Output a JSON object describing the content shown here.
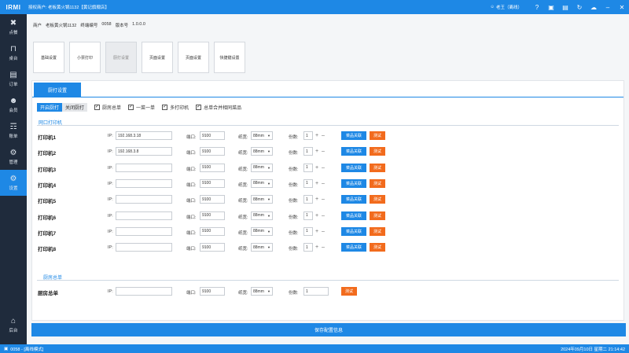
{
  "titlebar": {
    "logo": "IRMI",
    "title": "授权商户: 老板黄火锅1132【黄记旗舰店】",
    "user": "老王（离线）"
  },
  "sidebar": {
    "items": [
      {
        "label": "点餐",
        "icon": "utensils-icon"
      },
      {
        "label": "桌台",
        "icon": "table-icon"
      },
      {
        "label": "订单",
        "icon": "order-icon"
      },
      {
        "label": "会员",
        "icon": "member-icon"
      },
      {
        "label": "账单",
        "icon": "bill-icon"
      },
      {
        "label": "管理",
        "icon": "manage-icon"
      },
      {
        "label": "设置",
        "icon": "gear-icon"
      }
    ],
    "bottom": {
      "label": "后台",
      "icon": "backend-icon"
    }
  },
  "shop": {
    "merchant_label": "商户",
    "merchant": "老板黄火锅1132",
    "terminal_label": "终端编号",
    "terminal": "0058",
    "version_label": "版本号",
    "version": "1.0.0.0"
  },
  "tiles": [
    "基础设置",
    "小票打印",
    "厨打设置",
    "页面设置",
    "页面设置",
    "快捷键设置"
  ],
  "panel": {
    "tab": "厨打设置",
    "seg_on": "开启厨打",
    "seg_off": "关闭厨打",
    "checks": [
      "厨房总单",
      "一菜一单",
      "多打印机",
      "总单合并相同菜品"
    ],
    "section1": "网口打印机",
    "section2": "厨房总单",
    "ip_label": "IP:",
    "port_label": "端口:",
    "width_label": "纸宽:",
    "copies_label": "份数:",
    "link_label": "菜品关联",
    "test_label": "测试",
    "printers": [
      {
        "name": "打印机1",
        "ip": "192.168.3.18",
        "port": "9100",
        "width": "88mm",
        "copies": "1"
      },
      {
        "name": "打印机2",
        "ip": "192.168.3.8",
        "port": "9100",
        "width": "88mm",
        "copies": "1"
      },
      {
        "name": "打印机3",
        "ip": "",
        "port": "9100",
        "width": "88mm",
        "copies": "1"
      },
      {
        "name": "打印机4",
        "ip": "",
        "port": "9100",
        "width": "88mm",
        "copies": "1"
      },
      {
        "name": "打印机5",
        "ip": "",
        "port": "9100",
        "width": "88mm",
        "copies": "1"
      },
      {
        "name": "打印机6",
        "ip": "",
        "port": "9100",
        "width": "88mm",
        "copies": "1"
      },
      {
        "name": "打印机7",
        "ip": "",
        "port": "9100",
        "width": "88mm",
        "copies": "1"
      },
      {
        "name": "打印机8",
        "ip": "",
        "port": "9100",
        "width": "88mm",
        "copies": "1"
      }
    ],
    "kitchen": {
      "name": "厨房总单",
      "ip": "",
      "port": "9100",
      "width": "88mm",
      "copies": "1"
    }
  },
  "save_label": "保存配置信息",
  "status": {
    "left": "0058 - [离线模式]",
    "right": "2024年09月10日 星期二 21:14:42"
  }
}
